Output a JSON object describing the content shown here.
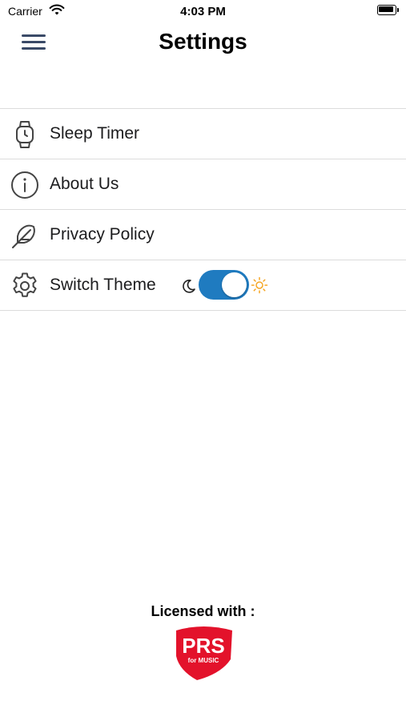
{
  "status_bar": {
    "carrier": "Carrier",
    "time": "4:03 PM"
  },
  "nav": {
    "title": "Settings"
  },
  "settings": {
    "items": [
      {
        "label": "Sleep Timer",
        "icon": "watch-icon"
      },
      {
        "label": "About Us",
        "icon": "info-icon"
      },
      {
        "label": "Privacy Policy",
        "icon": "feather-icon"
      },
      {
        "label": "Switch Theme",
        "icon": "gear-icon"
      }
    ],
    "theme_toggle": {
      "state": "on",
      "left_icon": "moon-icon",
      "right_icon": "sun-icon"
    }
  },
  "footer": {
    "licensed_label": "Licensed with :",
    "logo_text_main": "PRS",
    "logo_text_sub": "for MUSIC"
  },
  "colors": {
    "toggle_on": "#1f7bc0",
    "logo_red": "#e3122b",
    "sun": "#f5a623",
    "menu_icon": "#3a4a67"
  }
}
